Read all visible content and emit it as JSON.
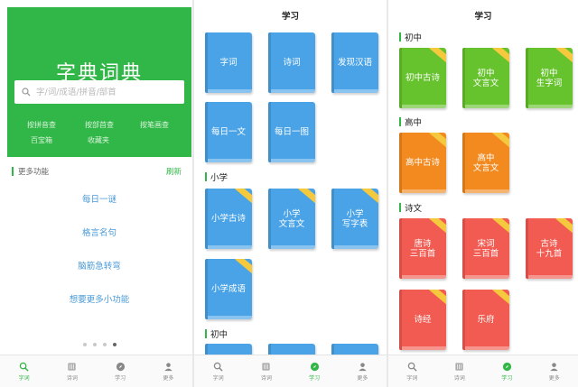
{
  "colors": {
    "brand": "#31b747",
    "book_blue": "#4aa3e6",
    "book_green": "#66c22d",
    "book_orange": "#f28a1f",
    "book_red": "#f25b52",
    "ribbon": "#f5c93e"
  },
  "panel1": {
    "title": "字典词典",
    "search": {
      "placeholder": "字/词/成语/拼音/部首"
    },
    "quick_links": [
      "按拼音查",
      "按部首查",
      "按笔画查",
      "百宝箱",
      "收藏夹"
    ],
    "more_features": {
      "label": "更多功能",
      "refresh": "刷新"
    },
    "features": [
      "每日一谜",
      "格言名句",
      "脑筋急转弯",
      "想要更多小功能"
    ],
    "pager": {
      "count": 4,
      "active": 4
    }
  },
  "panel2": {
    "header": "学习",
    "top_books": [
      "字词",
      "诗词",
      "发现汉语",
      "每日一文",
      "每日一图"
    ],
    "sections": [
      {
        "label": "小学",
        "books": [
          "小学古诗",
          "小学\n文言文",
          "小学\n写字表",
          "小学成语"
        ]
      },
      {
        "label": "初中"
      }
    ]
  },
  "panel3": {
    "header": "学习",
    "sections": [
      {
        "label": "初中",
        "books": [
          "初中古诗",
          "初中\n文言文",
          "初中\n生字词"
        ]
      },
      {
        "label": "高中",
        "books": [
          "高中古诗",
          "高中\n文言文"
        ]
      },
      {
        "label": "诗文",
        "books": [
          "唐诗\n三百首",
          "宋词\n三百首",
          "古诗\n十九首",
          "诗经",
          "乐府"
        ]
      }
    ]
  },
  "nav": [
    {
      "label": "字词",
      "icon": "search-icon"
    },
    {
      "label": "诗词",
      "icon": "book-icon"
    },
    {
      "label": "学习",
      "icon": "compass-icon"
    },
    {
      "label": "更多",
      "icon": "person-icon"
    }
  ],
  "nav_active": {
    "panel1": 0,
    "panel2": 2,
    "panel3": 2
  }
}
